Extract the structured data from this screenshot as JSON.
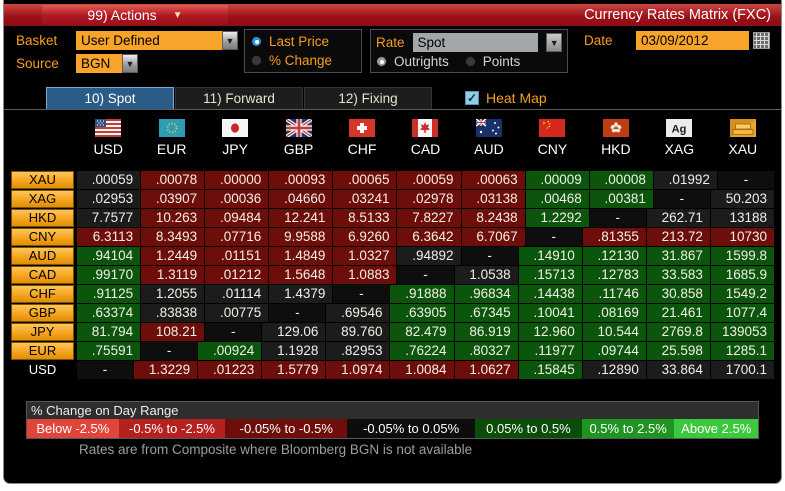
{
  "window": {
    "actions_label": "99) Actions",
    "title": "Currency Rates Matrix (FXC)"
  },
  "controls": {
    "basket_label": "Basket",
    "basket_value": "User Defined",
    "source_label": "Source",
    "source_value": "BGN",
    "price_radios": [
      {
        "label": "Last Price",
        "selected": true
      },
      {
        "label": "% Change",
        "selected": false
      }
    ],
    "rate_label": "Rate",
    "rate_value": "Spot",
    "rate_radios": [
      {
        "label": "Outrights",
        "selected": true
      },
      {
        "label": "Points",
        "selected": false
      }
    ],
    "date_label": "Date",
    "date_value": "03/09/2012",
    "calendar_icon": "calendar-grid",
    "dropdown_icon": "▼"
  },
  "tabs": [
    {
      "label": "10) Spot",
      "active": true
    },
    {
      "label": "11) Forward",
      "active": false
    },
    {
      "label": "12) Fixing",
      "active": false
    }
  ],
  "heatmap": {
    "label": "Heat Map",
    "checked": true,
    "check_glyph": "✓"
  },
  "matrix": {
    "columns": [
      "USD",
      "EUR",
      "JPY",
      "GBP",
      "CHF",
      "CAD",
      "AUD",
      "CNY",
      "HKD",
      "XAG",
      "XAU"
    ],
    "column_icons": [
      "flag-usd",
      "flag-eur",
      "flag-jpy",
      "flag-gbp",
      "flag-chf",
      "flag-cad",
      "flag-aud",
      "flag-cny",
      "flag-hkd",
      "silver-ag",
      "gold-bars"
    ],
    "rows": [
      {
        "label": "XAU",
        "label_style": "amber",
        "values": [
          ".00059",
          ".00078",
          ".00000",
          ".00093",
          ".00065",
          ".00059",
          ".00063",
          ".00009",
          ".00008",
          ".01992",
          "-"
        ],
        "colors": [
          "k",
          "r",
          "r",
          "r",
          "r",
          "r",
          "r",
          "g",
          "g",
          "k",
          "d"
        ]
      },
      {
        "label": "XAG",
        "label_style": "amber",
        "values": [
          ".02953",
          ".03907",
          ".00036",
          ".04660",
          ".03241",
          ".02978",
          ".03138",
          ".00468",
          ".00381",
          "-",
          "50.203"
        ],
        "colors": [
          "k",
          "r",
          "r",
          "r",
          "r",
          "r",
          "r",
          "g",
          "g",
          "d",
          "k"
        ]
      },
      {
        "label": "HKD",
        "label_style": "amber",
        "values": [
          "7.7577",
          "10.263",
          ".09484",
          "12.241",
          "8.5133",
          "7.8227",
          "8.2438",
          "1.2292",
          "-",
          "262.71",
          "13188"
        ],
        "colors": [
          "k",
          "r",
          "r",
          "r",
          "r",
          "r",
          "r",
          "g",
          "d",
          "k",
          "k"
        ]
      },
      {
        "label": "CNY",
        "label_style": "amber",
        "values": [
          "6.3113",
          "8.3493",
          ".07716",
          "9.9588",
          "6.9260",
          "6.3642",
          "6.7067",
          "-",
          ".81355",
          "213.72",
          "10730"
        ],
        "colors": [
          "r",
          "r",
          "r",
          "r",
          "r",
          "r",
          "r",
          "d",
          "r",
          "r",
          "r"
        ]
      },
      {
        "label": "AUD",
        "label_style": "amber",
        "values": [
          ".94104",
          "1.2449",
          ".01151",
          "1.4849",
          "1.0327",
          ".94892",
          "-",
          ".14910",
          ".12130",
          "31.867",
          "1599.8"
        ],
        "colors": [
          "g",
          "r",
          "r",
          "r",
          "r",
          "k",
          "d",
          "g",
          "g",
          "g",
          "g"
        ]
      },
      {
        "label": "CAD",
        "label_style": "amber",
        "values": [
          ".99170",
          "1.3119",
          ".01212",
          "1.5648",
          "1.0883",
          "-",
          "1.0538",
          ".15713",
          ".12783",
          "33.583",
          "1685.9"
        ],
        "colors": [
          "g",
          "r",
          "r",
          "r",
          "r",
          "d",
          "k",
          "g",
          "g",
          "g",
          "g"
        ]
      },
      {
        "label": "CHF",
        "label_style": "amber",
        "values": [
          ".91125",
          "1.2055",
          ".01114",
          "1.4379",
          "-",
          ".91888",
          ".96834",
          ".14438",
          ".11746",
          "30.858",
          "1549.2"
        ],
        "colors": [
          "g",
          "k",
          "k",
          "k",
          "d",
          "g",
          "g",
          "g",
          "g",
          "g",
          "g"
        ]
      },
      {
        "label": "GBP",
        "label_style": "amber",
        "values": [
          ".63374",
          ".83838",
          ".00775",
          "-",
          ".69546",
          ".63905",
          ".67345",
          ".10041",
          ".08169",
          "21.461",
          "1077.4"
        ],
        "colors": [
          "g",
          "k",
          "k",
          "d",
          "k",
          "g",
          "g",
          "g",
          "g",
          "g",
          "g"
        ]
      },
      {
        "label": "JPY",
        "label_style": "amber",
        "values": [
          "81.794",
          "108.21",
          "-",
          "129.06",
          "89.760",
          "82.479",
          "86.919",
          "12.960",
          "10.544",
          "2769.8",
          "139053"
        ],
        "colors": [
          "g",
          "r",
          "d",
          "k",
          "k",
          "g",
          "g",
          "g",
          "g",
          "g",
          "g"
        ]
      },
      {
        "label": "EUR",
        "label_style": "amber",
        "values": [
          ".75591",
          "-",
          ".00924",
          "1.1928",
          ".82953",
          ".76224",
          ".80327",
          ".11977",
          ".09744",
          "25.598",
          "1285.1"
        ],
        "colors": [
          "g",
          "d",
          "g",
          "k",
          "k",
          "g",
          "g",
          "g",
          "g",
          "g",
          "g"
        ]
      },
      {
        "label": "USD",
        "label_style": "plain",
        "values": [
          "-",
          "1.3229",
          ".01223",
          "1.5779",
          "1.0974",
          "1.0084",
          "1.0627",
          ".15845",
          ".12890",
          "33.864",
          "1700.1"
        ],
        "colors": [
          "d",
          "r",
          "r",
          "r",
          "r",
          "r",
          "r",
          "g",
          "k",
          "k",
          "k"
        ]
      }
    ]
  },
  "legend": {
    "title": "% Change on Day Range",
    "ranges": [
      {
        "label": "Below -2.5%",
        "color": "#e0443a"
      },
      {
        "label": "-0.5% to -2.5%",
        "color": "#b5211e"
      },
      {
        "label": "-0.05% to -0.5%",
        "color": "#6e0e0b"
      },
      {
        "label": "-0.05% to 0.05%",
        "color": "#0d0d0d"
      },
      {
        "label": "0.05% to 0.5%",
        "color": "#0b4c0b"
      },
      {
        "label": "0.5% to 2.5%",
        "color": "#219321"
      },
      {
        "label": "Above 2.5%",
        "color": "#3cc83c"
      }
    ]
  },
  "footer": "Rates are from Composite where Bloomberg BGN is not available",
  "colors": {
    "accent_orange": "#f79e20",
    "topbar_red": "#a8141e",
    "cell_dark_red": "#6e0e0b",
    "cell_green": "#0b560c",
    "cell_neutral": "#1c1c1c",
    "active_tab_blue": "#2b5c88"
  }
}
